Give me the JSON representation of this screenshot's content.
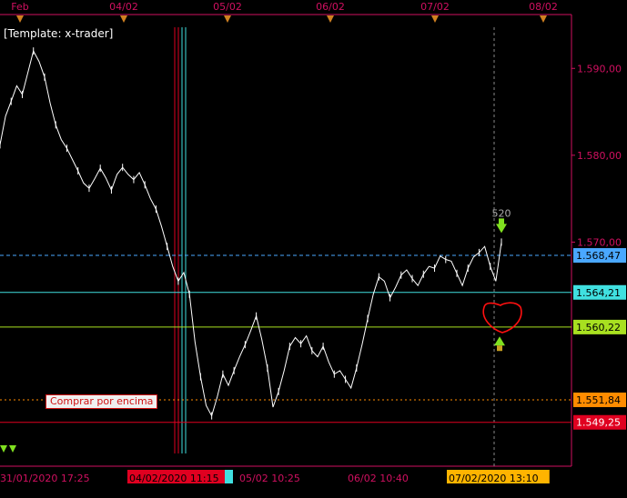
{
  "template_label": "[Template: x-trader]",
  "comprar_label": "Comprar por encima",
  "trade_label": "520",
  "colors": {
    "axis": "#d01060",
    "price_line": "#ffffff",
    "blue_level": "#4aa8ff",
    "cyan_level": "#40e0e0",
    "lime_level": "#a8e020",
    "orange_level": "#ff8c00",
    "red_level": "#e00020",
    "buy_arrow": "#80e020",
    "annotation_circle": "#ff1010"
  },
  "chart_data": {
    "type": "line",
    "title": "",
    "xlabel": "",
    "ylabel": "",
    "y_axis": {
      "range": [
        1.5442,
        1.5962
      ],
      "ticks": [
        "1.590,00",
        "1.580,00",
        "1.570,00"
      ]
    },
    "x_axis": {
      "top_labels": [
        "Feb",
        "04/02",
        "05/02",
        "06/02",
        "07/02",
        "08/02"
      ],
      "bottom_labels": [
        "31/01/2020 17:25",
        "04/02/2020 11:15",
        "05/02 10:25",
        "06/02 10:40",
        "07/02/2020 13:10"
      ]
    },
    "price_levels": [
      {
        "label": "1.568,47",
        "value": 1.56847,
        "color": "#4aa8ff",
        "style": "dashed"
      },
      {
        "label": "1.564,21",
        "value": 1.56421,
        "color": "#40e0e0",
        "style": "solid"
      },
      {
        "label": "1.560,22",
        "value": 1.56022,
        "color": "#a8e020",
        "style": "solid"
      },
      {
        "label": "1.551,84",
        "value": 1.55184,
        "color": "#ff8c00",
        "style": "dotted"
      },
      {
        "label": "1.549,25",
        "value": 1.54925,
        "color": "#e00020",
        "style": "solid"
      }
    ],
    "series": [
      {
        "values": [
          1.5812,
          1.5845,
          1.5862,
          1.588,
          1.587,
          1.5895,
          1.592,
          1.5908,
          1.589,
          1.586,
          1.5835,
          1.5818,
          1.5808,
          1.5795,
          1.5782,
          1.5768,
          1.5762,
          1.5773,
          1.5785,
          1.5774,
          1.576,
          1.5778,
          1.5786,
          1.5778,
          1.5772,
          1.578,
          1.5766,
          1.575,
          1.5738,
          1.5718,
          1.5695,
          1.5672,
          1.5655,
          1.5665,
          1.564,
          1.5585,
          1.5545,
          1.5512,
          1.55,
          1.5522,
          1.5548,
          1.5535,
          1.5552,
          1.5568,
          1.5582,
          1.5598,
          1.5615,
          1.5588,
          1.5555,
          1.551,
          1.5528,
          1.5552,
          1.558,
          1.559,
          1.5583,
          1.5592,
          1.5575,
          1.5568,
          1.558,
          1.5562,
          1.5548,
          1.5552,
          1.5542,
          1.5532,
          1.5555,
          1.5582,
          1.5612,
          1.564,
          1.566,
          1.5655,
          1.5636,
          1.5648,
          1.5662,
          1.5668,
          1.5658,
          1.565,
          1.5663,
          1.5672,
          1.567,
          1.5684,
          1.568,
          1.5678,
          1.5664,
          1.565,
          1.567,
          1.5683,
          1.5688,
          1.5695,
          1.5672,
          1.5655,
          1.57
        ]
      }
    ],
    "markers": [
      {
        "type": "buy",
        "label": "520",
        "value": 1.57
      },
      {
        "type": "buy",
        "label": "",
        "value": 1.5583
      }
    ],
    "grid": false
  }
}
